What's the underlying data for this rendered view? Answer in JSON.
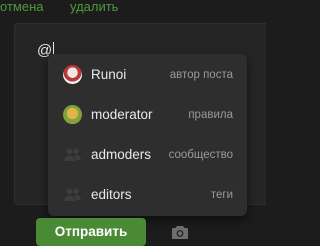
{
  "toolbar": {
    "cancel": "отмена",
    "delete": "удалить"
  },
  "editor": {
    "text": "@"
  },
  "mentions": [
    {
      "name": "Runoi",
      "role": "автор поста",
      "avatar": "user-avatar"
    },
    {
      "name": "moderator",
      "role": "правила",
      "avatar": "user-avatar"
    },
    {
      "name": "admoders",
      "role": "сообщество",
      "avatar": "group-icon"
    },
    {
      "name": "editors",
      "role": "теги",
      "avatar": "group-icon"
    }
  ],
  "footer": {
    "send_label": "Отправить",
    "attach_icon": "camera-icon"
  },
  "colors": {
    "accent": "#4a8a35",
    "link": "#4f9a3f",
    "popup_bg": "#2e2e2e",
    "page_bg": "#1c1c1c"
  }
}
